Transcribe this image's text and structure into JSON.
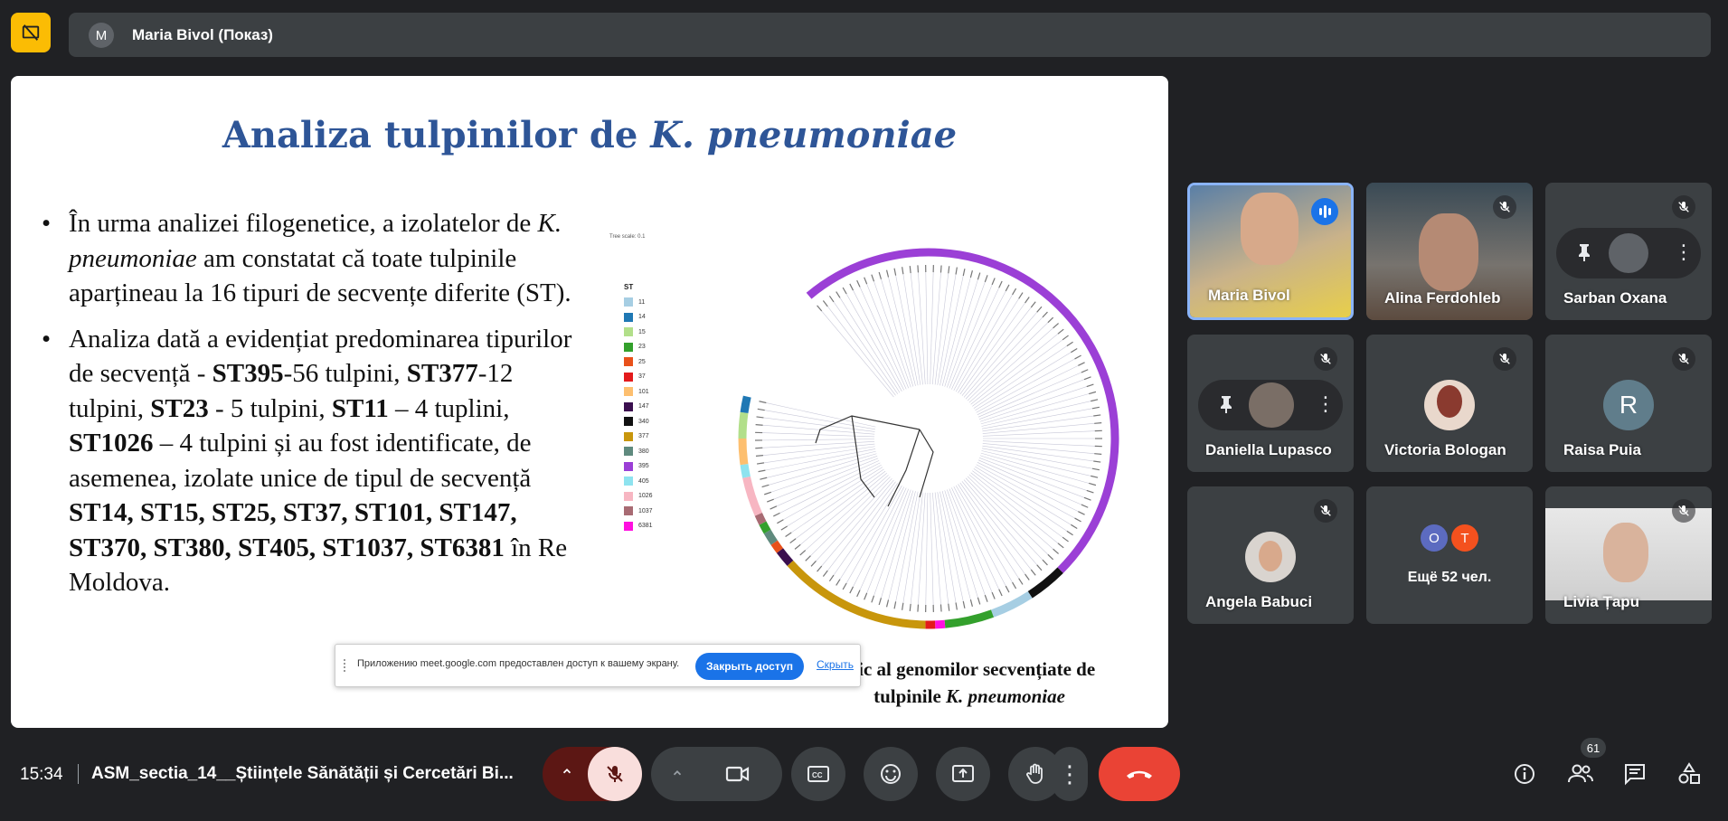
{
  "presenter": {
    "avatar_letter": "M",
    "name": "Maria Bivol (Показ)"
  },
  "slide": {
    "title_plain": "Analiza tulpinilor de ",
    "title_italic": "K. pneumoniae",
    "bullet1": {
      "t1": "În urma analizei filogenetice, a izolatelor de ",
      "i1": "K. pneumoniae",
      "t2": " am constatat că toate tulpinile aparțineau la 16 tipuri de secvențe diferite (ST)."
    },
    "bullet2": {
      "t1": "Analiza dată a evidențiat predominarea tipurilor de secvență - ",
      "b1": "ST395",
      "t2": "-56 tulpini, ",
      "b2": "ST377",
      "t3": "-12 tulpini, ",
      "b3": "ST23",
      "t4": " - 5 tulpini, ",
      "b4": "ST11",
      "t5": " – 4 tuplini, ",
      "b5": "ST1026",
      "t6": " – 4 tulpini și au fost identificate, de asemenea, izolate unice de tipul de secvență ",
      "b6": "ST14, ST15, ST25, ST37, ST101, ST147, ST370, ST380, ST405, ST1037, ST6381",
      "t7": " în Re",
      "t8": "Moldova."
    },
    "tree_scale": "Tree scale: 0.1",
    "legend_title": "ST",
    "legend": [
      {
        "label": "11",
        "color": "#a6cee3"
      },
      {
        "label": "14",
        "color": "#1f78b4"
      },
      {
        "label": "15",
        "color": "#b2df8a"
      },
      {
        "label": "23",
        "color": "#33a02c"
      },
      {
        "label": "25",
        "color": "#e8511a"
      },
      {
        "label": "37",
        "color": "#e31a1c"
      },
      {
        "label": "101",
        "color": "#fdbf6f"
      },
      {
        "label": "147",
        "color": "#3b0f4f"
      },
      {
        "label": "340",
        "color": "#111111"
      },
      {
        "label": "377",
        "color": "#c8960c"
      },
      {
        "label": "380",
        "color": "#5f8a7e"
      },
      {
        "label": "395",
        "color": "#9b3fd6"
      },
      {
        "label": "405",
        "color": "#8ee3ef"
      },
      {
        "label": "1026",
        "color": "#f7b6c2"
      },
      {
        "label": "1037",
        "color": "#a86b73"
      },
      {
        "label": "6381",
        "color": "#ff10e0"
      }
    ],
    "caption_t1": "etic al genomilor secvențiate de",
    "caption_t2": "tulpinile ",
    "caption_i": "K. pneumoniae"
  },
  "share_notice": {
    "text": "Приложению meet.google.com предоставлен доступ к вашему экрану.",
    "stop_label": "Закрыть доступ",
    "hide_label": "Скрыть"
  },
  "participants": [
    {
      "name": "Maria Bivol",
      "state": "speaking"
    },
    {
      "name": "Alina Ferdohleb",
      "state": "muted"
    },
    {
      "name": "Sarban Oxana",
      "state": "muted"
    },
    {
      "name": "Daniella Lupasco",
      "state": "muted"
    },
    {
      "name": "Victoria Bologan",
      "state": "muted"
    },
    {
      "name": "Raisa Puia",
      "state": "muted",
      "avatar_letter": "R"
    },
    {
      "name": "Angela Babuci",
      "state": "muted"
    },
    {
      "name": "Ещё 52 чел.",
      "avatar_letters": [
        "O",
        "T"
      ]
    },
    {
      "name": "Livia Țapu",
      "state": "muted"
    }
  ],
  "bottom": {
    "time": "15:34",
    "meeting_title": "ASM_sectia_14__Științele Sănătății și Cercetări Bi...",
    "people_count": "61"
  },
  "colors": {
    "accent": "#8ab4f8",
    "end_call": "#ea4335",
    "share_button": "#1a73e8",
    "present_icon": "#fbbc04"
  }
}
